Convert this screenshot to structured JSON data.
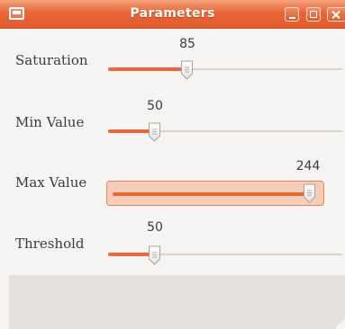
{
  "window": {
    "title": "Parameters",
    "icon": "window-app-icon",
    "buttons": [
      "minimize-icon",
      "maximize-icon",
      "close-icon"
    ]
  },
  "colors": {
    "accent": "#e9673a",
    "titlebar": "#e9673a",
    "trough": "#d8d5d1",
    "panel": "#e5e2de"
  },
  "sliders": [
    {
      "label": "Saturation",
      "value": "85",
      "fraction": 0.333
    },
    {
      "label": "Min Value",
      "value": "50",
      "fraction": 0.196
    },
    {
      "label": "Max Value",
      "value": "244",
      "fraction": 0.957,
      "focused": true
    },
    {
      "label": "Threshold",
      "value": "50",
      "fraction": 0.196
    }
  ]
}
